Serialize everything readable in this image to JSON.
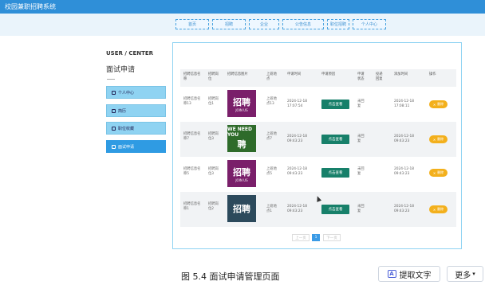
{
  "app": {
    "title": "校园兼职招聘系统"
  },
  "nav": {
    "items": [
      "首页",
      "招聘",
      "企业",
      "公告信息",
      "职位招聘",
      "个人中心"
    ]
  },
  "sidebar": {
    "title": "USER / CENTER",
    "subtitle": "面试申请",
    "items": [
      {
        "label": "个人中心",
        "icon": "user-icon"
      },
      {
        "label": "简历",
        "icon": "resume-icon"
      },
      {
        "label": "职位收藏",
        "icon": "star-icon"
      },
      {
        "label": "面试申请",
        "icon": "calendar-icon"
      }
    ]
  },
  "table": {
    "headers": [
      "招聘信息名称",
      "招聘岗位",
      "招聘信息图片",
      "上班地点",
      "申请时间",
      "申请原因",
      "申请状态",
      "投递回复",
      "添加时间",
      "操作"
    ],
    "rows": [
      {
        "name": "招聘信息名称13",
        "post": "招聘岗位1",
        "img_text": "招聘",
        "img_sub": "JOIN US",
        "img_color": "#7a1f6a",
        "place": "上班地点13",
        "apply_time": "2024-12-18 17:07:54",
        "reason": "点击查看",
        "status": "未回复",
        "reply": "",
        "add_time": "2024-12-18 17:08:11",
        "action": "删除"
      },
      {
        "name": "招聘信息名称7",
        "post": "招聘岗位3",
        "img_text": "WE NEED YOU",
        "img_sub": "聘",
        "img_color": "#2e6b2a",
        "place": "上班地点7",
        "apply_time": "2024-12-18 09:43:23",
        "reason": "点击查看",
        "status": "未回复",
        "reply": "",
        "add_time": "2024-12-18 09:43:23",
        "action": "删除"
      },
      {
        "name": "招聘信息名称5",
        "post": "招聘岗位3",
        "img_text": "招聘",
        "img_sub": "JOIN US",
        "img_color": "#7a1f6a",
        "place": "上班地点5",
        "apply_time": "2024-12-18 09:43:23",
        "reason": "点击查看",
        "status": "未回复",
        "reply": "",
        "add_time": "2024-12-18 09:43:23",
        "action": "删除"
      },
      {
        "name": "招聘信息名称1",
        "post": "招聘岗位2",
        "img_text": "招聘",
        "img_sub": "",
        "img_color": "#2c4a5c",
        "place": "上班地点1",
        "apply_time": "2024-12-18 09:43:23",
        "reason": "点击查看",
        "status": "未回复",
        "reply": "",
        "add_time": "2024-12-18 09:43:23",
        "action": "删除"
      }
    ]
  },
  "pagination": {
    "prev": "上一页",
    "current": "1",
    "next": "下一页"
  },
  "caption": "图 5.4  面试申请管理页面",
  "toolbar": {
    "ocr_label": "提取文字",
    "more_label": "更多"
  }
}
